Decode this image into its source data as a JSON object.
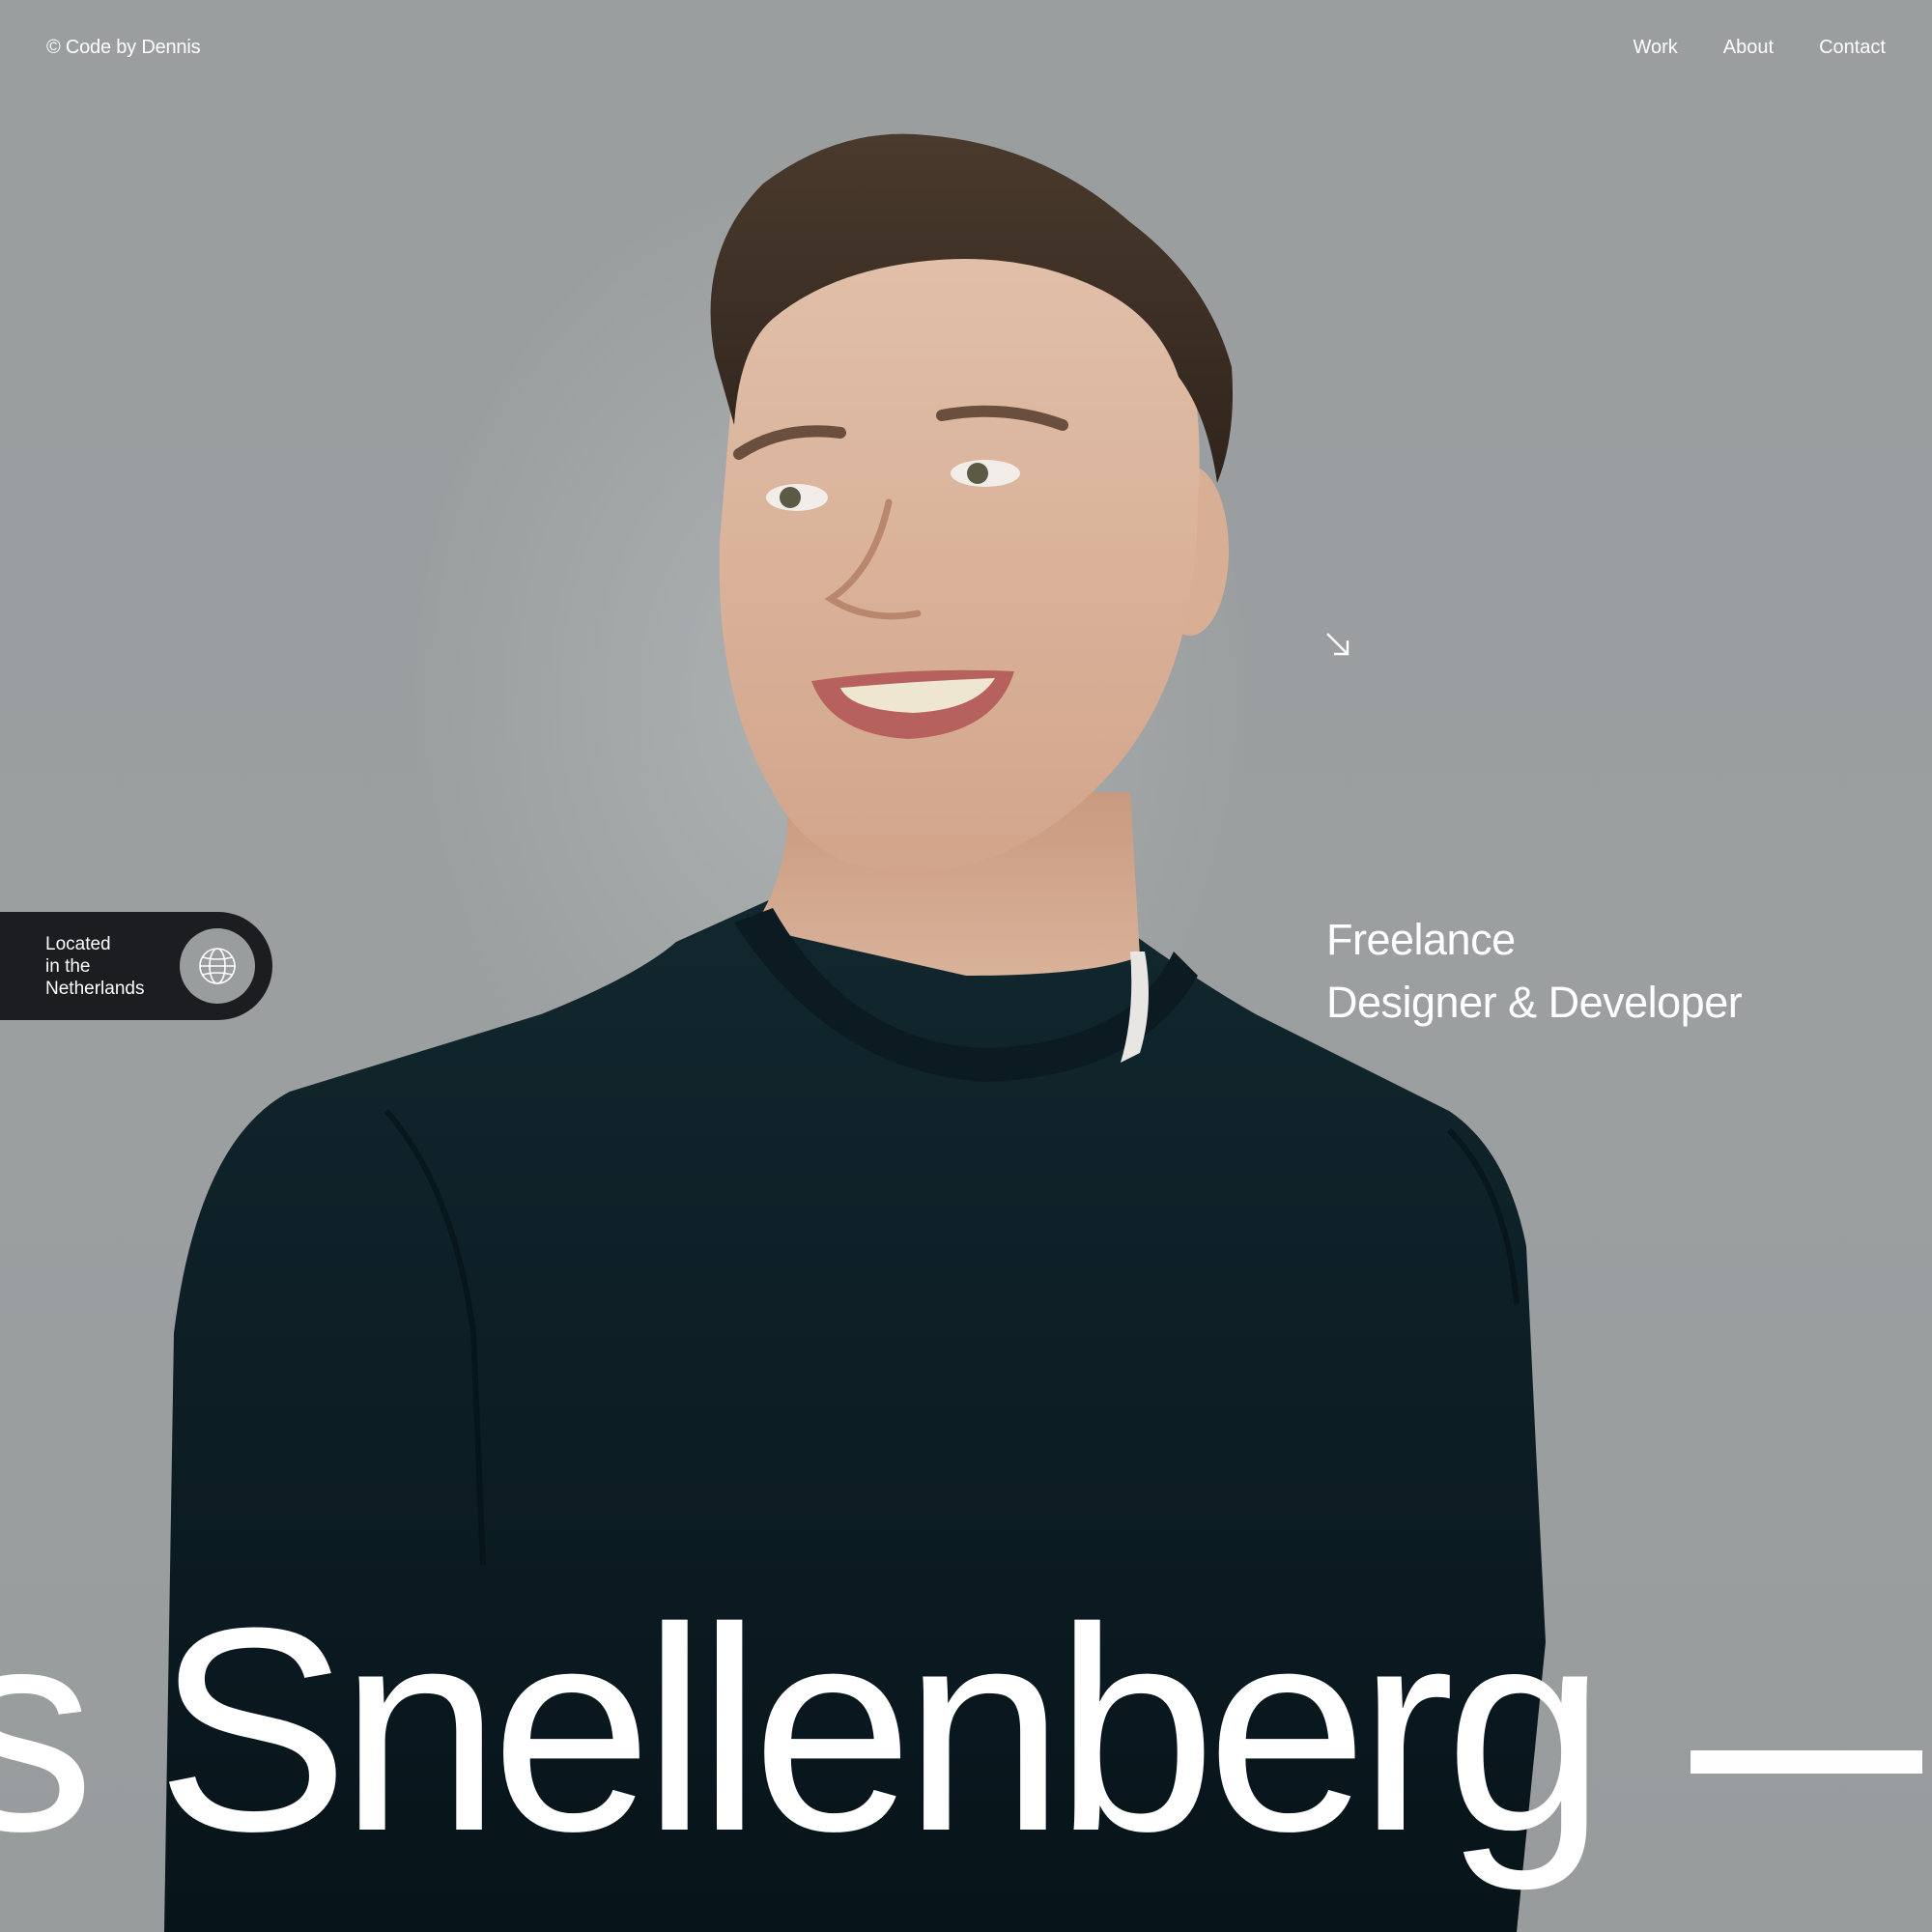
{
  "header": {
    "brand": "© Code by Dennis",
    "nav": [
      {
        "label": "Work"
      },
      {
        "label": "About"
      },
      {
        "label": "Contact"
      }
    ]
  },
  "location": {
    "line1": "Located",
    "line2": "in the",
    "line3": "Netherlands",
    "icon": "globe-icon"
  },
  "hero": {
    "arrow_icon": "arrow-down-right-icon",
    "role_line1": "Freelance",
    "role_line2": "Designer & Developer",
    "marquee_text": "s Snellenberg"
  },
  "colors": {
    "background": "#999d9e",
    "pill": "#1c1d20",
    "text": "#ffffff",
    "sweater": "#0e1e24"
  }
}
